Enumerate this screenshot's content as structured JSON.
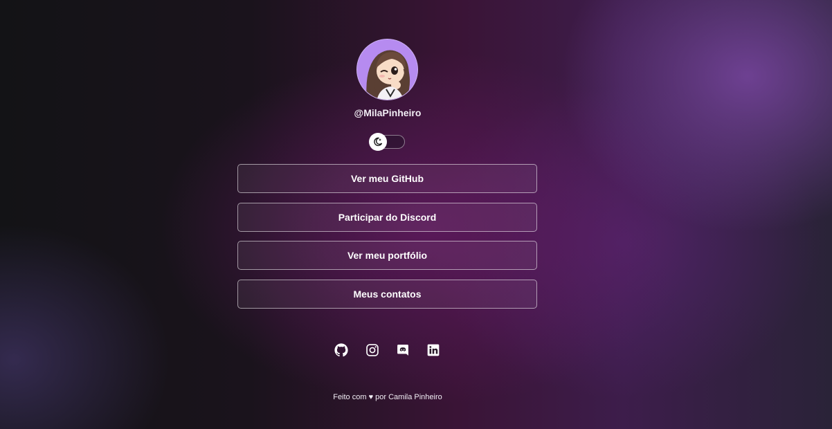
{
  "profile": {
    "username": "@MilaPinheiro",
    "avatar_icon": "anime-girl-avatar"
  },
  "theme_toggle": {
    "icon": "moon-icon",
    "state": "dark"
  },
  "links": [
    {
      "label": "Ver meu GitHub"
    },
    {
      "label": "Participar do Discord"
    },
    {
      "label": "Ver meu portfólio"
    },
    {
      "label": "Meus contatos"
    }
  ],
  "socials": [
    {
      "icon": "github-icon"
    },
    {
      "icon": "instagram-icon"
    },
    {
      "icon": "discord-icon"
    },
    {
      "icon": "linkedin-icon"
    }
  ],
  "footer": {
    "text": "Feito com ♥ por Camila Pinheiro"
  }
}
